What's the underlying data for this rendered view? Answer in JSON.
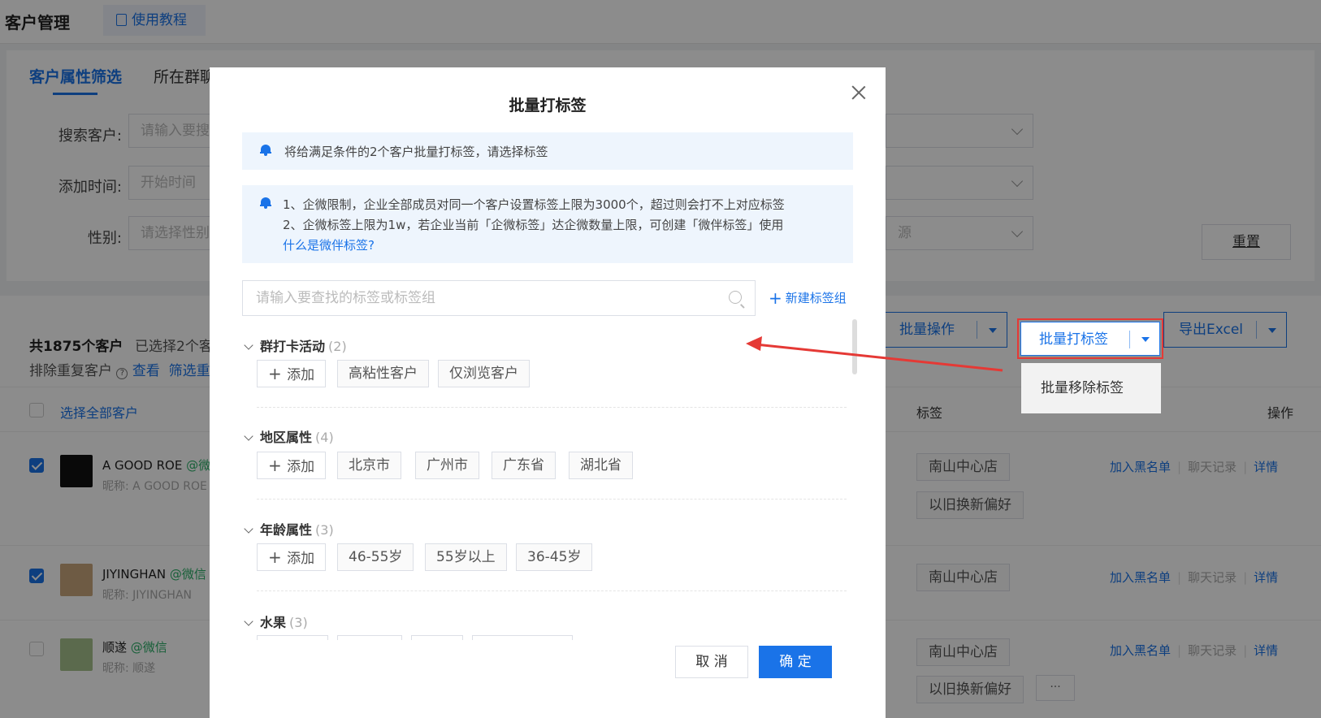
{
  "topbar": {
    "title": "客户管理",
    "tutorial": "使用教程"
  },
  "filters": {
    "tabs": [
      "客户属性筛选",
      "所在群聊"
    ],
    "search_label": "搜索客户:",
    "search_placeholder": "请输入要搜",
    "time_label": "添加时间:",
    "time_placeholder": "开始时间",
    "gender_label": "性别:",
    "gender_placeholder": "请选择性别",
    "source_placeholder": "源",
    "reset": "重置"
  },
  "list": {
    "total": "共1875个客户",
    "selected": "已选择2个客",
    "dedupe_text": "排除重复客户",
    "dedupe_view": "查看",
    "dedupe_filter": "筛选重",
    "actions": {
      "batch_ops": "批量操作",
      "batch_tag": "批量打标签",
      "export": "导出Excel"
    },
    "dropdown_item": "批量移除标签",
    "header": {
      "select_all": "选择全部客户",
      "tags": "标签",
      "ops": "操作"
    },
    "rows": [
      {
        "name": "A GOOD ROE",
        "suffix": "@微",
        "nick": "昵称:  A GOOD ROE",
        "checked": true,
        "tags": [
          "南山中心店",
          "以旧换新偏好"
        ]
      },
      {
        "name": "JIYINGHAN",
        "suffix": "@微信",
        "nick": "昵称:  JIYINGHAN",
        "checked": true,
        "tags": [
          "南山中心店"
        ]
      },
      {
        "name": "顺遂",
        "suffix": "@微信",
        "nick": "昵称:  顺遂",
        "checked": false,
        "tags": [
          "南山中心店",
          "以旧换新偏好"
        ]
      }
    ],
    "ops_labels": {
      "blacklist": "加入黑名单",
      "chat": "聊天记录",
      "detail": "详情"
    },
    "more": "···"
  },
  "modal": {
    "title": "批量打标签",
    "notice": "将给满足条件的2个客户批量打标签，请选择标签",
    "limits_line1": "1、企微限制，企业全部成员对同一个客户设置标签上限为3000个，超过则会打不上对应标签",
    "limits_line2": "2、企微标签上限为1w，若企业当前「企微标签」达企微数量上限，可创建「微伴标签」使用",
    "limits_link": "什么是微伴标签?",
    "search_placeholder": "请输入要查找的标签或标签组",
    "new_group": "新建标签组",
    "add_label": "添加",
    "groups": [
      {
        "name": "群打卡活动",
        "count": "(2)",
        "tags": [
          "高粘性客户",
          "仅浏览客户"
        ]
      },
      {
        "name": "地区属性",
        "count": "(4)",
        "tags": [
          "北京市",
          "广州市",
          "广东省",
          "湖北省"
        ]
      },
      {
        "name": "年龄属性",
        "count": "(3)",
        "tags": [
          "46-55岁",
          "55岁以上",
          "36-45岁"
        ]
      },
      {
        "name": "水果",
        "count": "(3)",
        "tags": []
      }
    ],
    "cancel": "取 消",
    "ok": "确 定"
  },
  "colors": {
    "accent": "#1a73e8",
    "highlight": "#e53935",
    "wechat": "#2aae67"
  }
}
